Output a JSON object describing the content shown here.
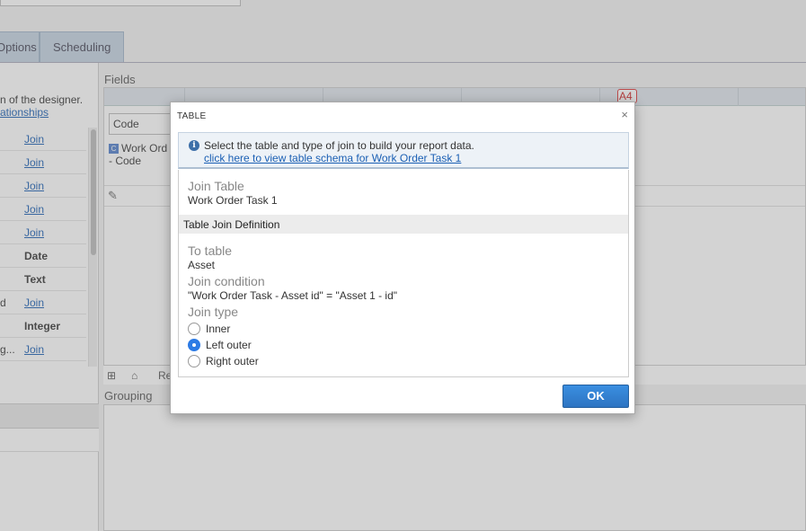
{
  "tabs": [
    {
      "label": "Options"
    },
    {
      "label": "Scheduling"
    }
  ],
  "left_panel": {
    "intro_line1": "n of the designer.",
    "intro_link": "ationships",
    "rows": [
      {
        "prefix": "",
        "value": "Join",
        "kind": "link"
      },
      {
        "prefix": "",
        "value": "Join",
        "kind": "link"
      },
      {
        "prefix": "",
        "value": "Join",
        "kind": "link"
      },
      {
        "prefix": "",
        "value": "Join",
        "kind": "link"
      },
      {
        "prefix": "",
        "value": "Join",
        "kind": "link"
      },
      {
        "prefix": "",
        "value": "Date",
        "kind": "bold"
      },
      {
        "prefix": "",
        "value": "Text",
        "kind": "bold"
      },
      {
        "prefix": "d",
        "value": "Join",
        "kind": "link"
      },
      {
        "prefix": "",
        "value": "Integer",
        "kind": "bold"
      },
      {
        "prefix": "g...",
        "value": "Join",
        "kind": "link"
      }
    ]
  },
  "fields": {
    "section_label": "Fields",
    "code_value": "Code",
    "field_badge": "C",
    "field_line1": "Work Ord",
    "field_line2": "- Code",
    "a4_badge": "A4",
    "footer_text": "Re"
  },
  "grouping": {
    "section_label": "Grouping"
  },
  "dialog": {
    "title": "TABLE",
    "close": "×",
    "info_text": "Select the table and type of join to build your report data.",
    "info_link": "click here to view table schema for Work Order Task 1",
    "join_table_label": "Join Table",
    "join_table_value": "Work Order Task 1",
    "band_label": "Table Join Definition",
    "to_table_label": "To table",
    "to_table_value": "Asset",
    "join_condition_label": "Join condition",
    "join_condition_value": "\"Work Order Task - Asset id\" = \"Asset 1 - id\"",
    "join_type_label": "Join type",
    "join_types": [
      {
        "label": "Inner",
        "selected": false
      },
      {
        "label": "Left outer",
        "selected": true
      },
      {
        "label": "Right outer",
        "selected": false
      }
    ],
    "ok_label": "OK"
  }
}
